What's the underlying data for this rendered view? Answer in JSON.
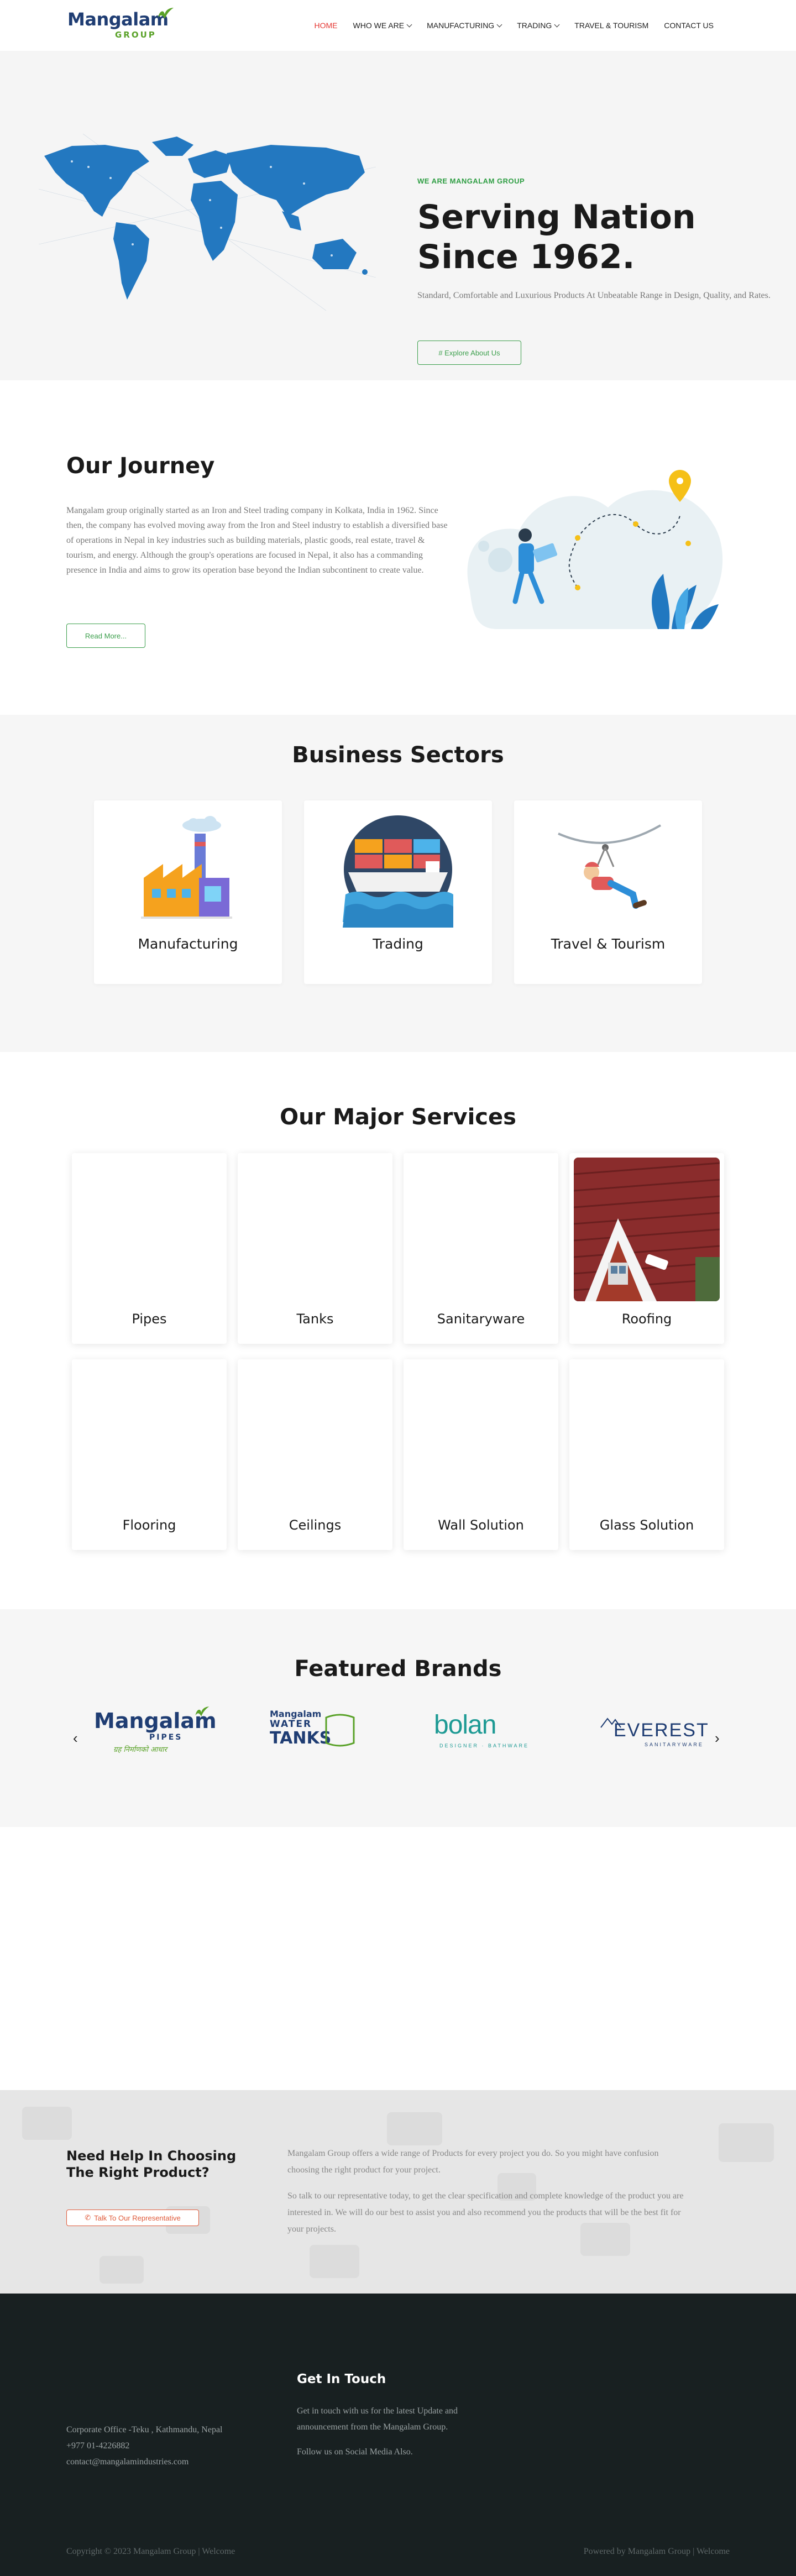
{
  "nav": {
    "logo_main": "Mangalam",
    "logo_sub": "GROUP",
    "items": [
      {
        "label": "HOME",
        "dropdown": false
      },
      {
        "label": "WHO WE ARE",
        "dropdown": true
      },
      {
        "label": "MANUFACTURING",
        "dropdown": true
      },
      {
        "label": "TRADING",
        "dropdown": true
      },
      {
        "label": "TRAVEL & TOURISM",
        "dropdown": false
      },
      {
        "label": "CONTACT US",
        "dropdown": false
      }
    ],
    "active_color": "#e53935"
  },
  "hero": {
    "eyebrow": "WE ARE MANGALAM GROUP",
    "title_line1": "Serving Nation",
    "title_line2": "Since 1962.",
    "description": "Standard, Comfortable and Luxurious Products At Unbeatable Range in Design, Quality, and Rates.",
    "button": "# Explore About Us"
  },
  "journey": {
    "title": "Our Journey",
    "text": "Mangalam group originally started as an Iron and Steel trading company in Kolkata, India in 1962. Since then, the company has evolved moving away from the Iron and Steel industry to establish a diversified base of operations in Nepal in key industries such as building materials, plastic goods, real estate, travel & tourism, and energy.  Although the group's operations are focused in Nepal, it also has a commanding presence in India and aims to grow its operation base beyond the Indian subcontinent to create value.",
    "button": "Read More..."
  },
  "sectors": {
    "title": "Business Sectors",
    "items": [
      "Manufacturing",
      "Trading",
      "Travel & Tourism"
    ]
  },
  "services": {
    "title": "Our Major Services",
    "items": [
      "Pipes",
      "Tanks",
      "Sanitaryware",
      "Roofing",
      "Flooring",
      "Ceilings",
      "Wall Solution",
      "Glass Solution"
    ]
  },
  "brands": {
    "title": "Featured Brands",
    "items": [
      {
        "name": "Mangalam",
        "sub": "PIPES",
        "tagline": "ग्रह निर्माणको आधार"
      },
      {
        "name": "Mangalam",
        "line2": "WATER",
        "line3": "TANKS"
      },
      {
        "name": "bolan",
        "sub": "DESIGNER · BATHWARE"
      },
      {
        "name": "EVEREST",
        "sub": "SANITARYWARE"
      }
    ],
    "prev": "‹",
    "next": "›"
  },
  "help": {
    "title": "Need Help In Choosing The Right Product?",
    "button": "Talk To Our Representative",
    "para1": "Mangalam Group offers a wide range of Products for every project you do.  So you might have confusion choosing the right product for your project.",
    "para2": "So talk to our representative today, to get the clear specification and complete knowledge of the product you are interested in. We will do our best to assist you and also recommend you the products that will be the best fit for your projects."
  },
  "footer": {
    "address": "Corporate Office -Teku , Kathmandu, Nepal",
    "phone": "+977 01-4226882",
    "email": "contact@mangalamindustries.com",
    "contact_title": "Get In Touch",
    "contact_text": "Get in touch with us for the latest Update and announcement from the Mangalam Group.",
    "social": "Follow us on Social Media Also.",
    "copyright": "Copyright © 2023 Mangalam Group | Welcome",
    "powered": "Powered by Mangalam Group | Welcome"
  }
}
